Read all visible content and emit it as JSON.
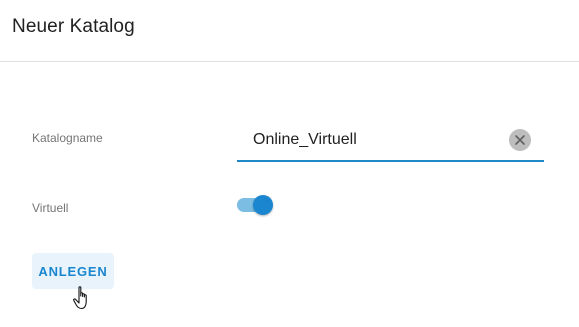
{
  "dialog": {
    "title": "Neuer Katalog"
  },
  "form": {
    "catalog_name_label": "Katalogname",
    "catalog_name_value": "Online_Virtuell",
    "clear_icon": "close-icon",
    "virtual_label": "Virtuell",
    "virtual_enabled": true
  },
  "actions": {
    "create_label": "ANLEGEN"
  },
  "colors": {
    "accent": "#1a86cf",
    "toggle_track": "#7bbde3",
    "button_bg": "#e8f3fb"
  }
}
